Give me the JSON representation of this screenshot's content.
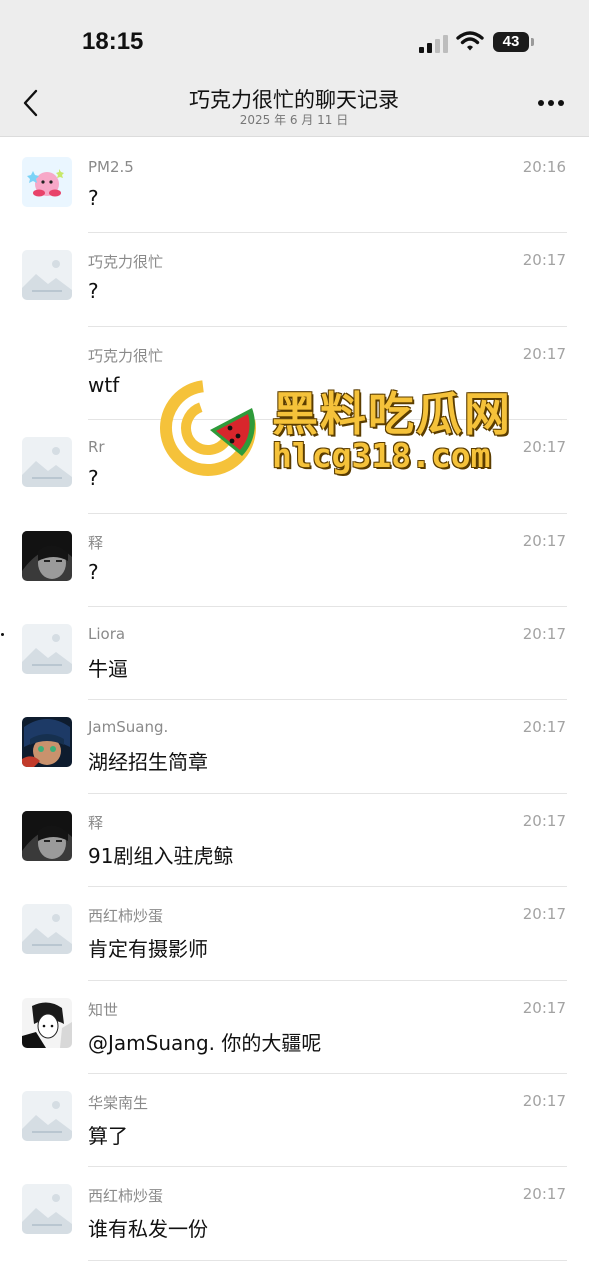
{
  "status_bar": {
    "time": "18:15",
    "battery": "43",
    "icons": [
      "cellular-signal-icon",
      "wifi-icon",
      "battery-icon"
    ]
  },
  "nav": {
    "back_icon": "chevron-left-icon",
    "title": "巧克力很忙的聊天记录",
    "subtitle": "2025 年 6 月 11 日",
    "more_icon": "more-dots-icon"
  },
  "messages": [
    {
      "name": "PM2.5",
      "time": "20:16",
      "text": "?",
      "avatar": "kirby-avatar"
    },
    {
      "name": "巧克力很忙",
      "time": "20:17",
      "text": "?",
      "avatar": "placeholder-avatar"
    },
    {
      "name": "巧克力很忙",
      "time": "20:17",
      "text": "wtf",
      "avatar": "none"
    },
    {
      "name": "Rr",
      "time": "20:17",
      "text": "?",
      "avatar": "placeholder-avatar"
    },
    {
      "name": "释",
      "time": "20:17",
      "text": "?",
      "avatar": "anime-dark-avatar"
    },
    {
      "name": "Liora",
      "time": "20:17",
      "text": "牛逼",
      "avatar": "placeholder-avatar"
    },
    {
      "name": "JamSuang.",
      "time": "20:17",
      "text": "湖经招生简章",
      "avatar": "anime-blue-avatar"
    },
    {
      "name": "释",
      "time": "20:17",
      "text": "91剧组入驻虎鲸",
      "avatar": "anime-dark-avatar"
    },
    {
      "name": "西红柿炒蛋",
      "time": "20:17",
      "text": "肯定有摄影师",
      "avatar": "placeholder-avatar"
    },
    {
      "name": "知世",
      "time": "20:17",
      "text": "@JamSuang. 你的大疆呢",
      "avatar": "manga-avatar"
    },
    {
      "name": "华棠南生",
      "time": "20:17",
      "text": "算了",
      "avatar": "placeholder-avatar"
    },
    {
      "name": "西红柿炒蛋",
      "time": "20:17",
      "text": "谁有私发一份",
      "avatar": "placeholder-avatar"
    }
  ],
  "watermark": {
    "brand": "黑料吃瓜网",
    "url": "hlcg318.com"
  },
  "colors": {
    "nav_bg": "#ededed",
    "divider": "#e4e4e4",
    "name": "#8a8a8a",
    "timestamp": "#a3a3a3",
    "watermark_yellow": "#f5c23a",
    "watermark_green": "#2e9b3a",
    "watermark_red": "#d8262c"
  }
}
